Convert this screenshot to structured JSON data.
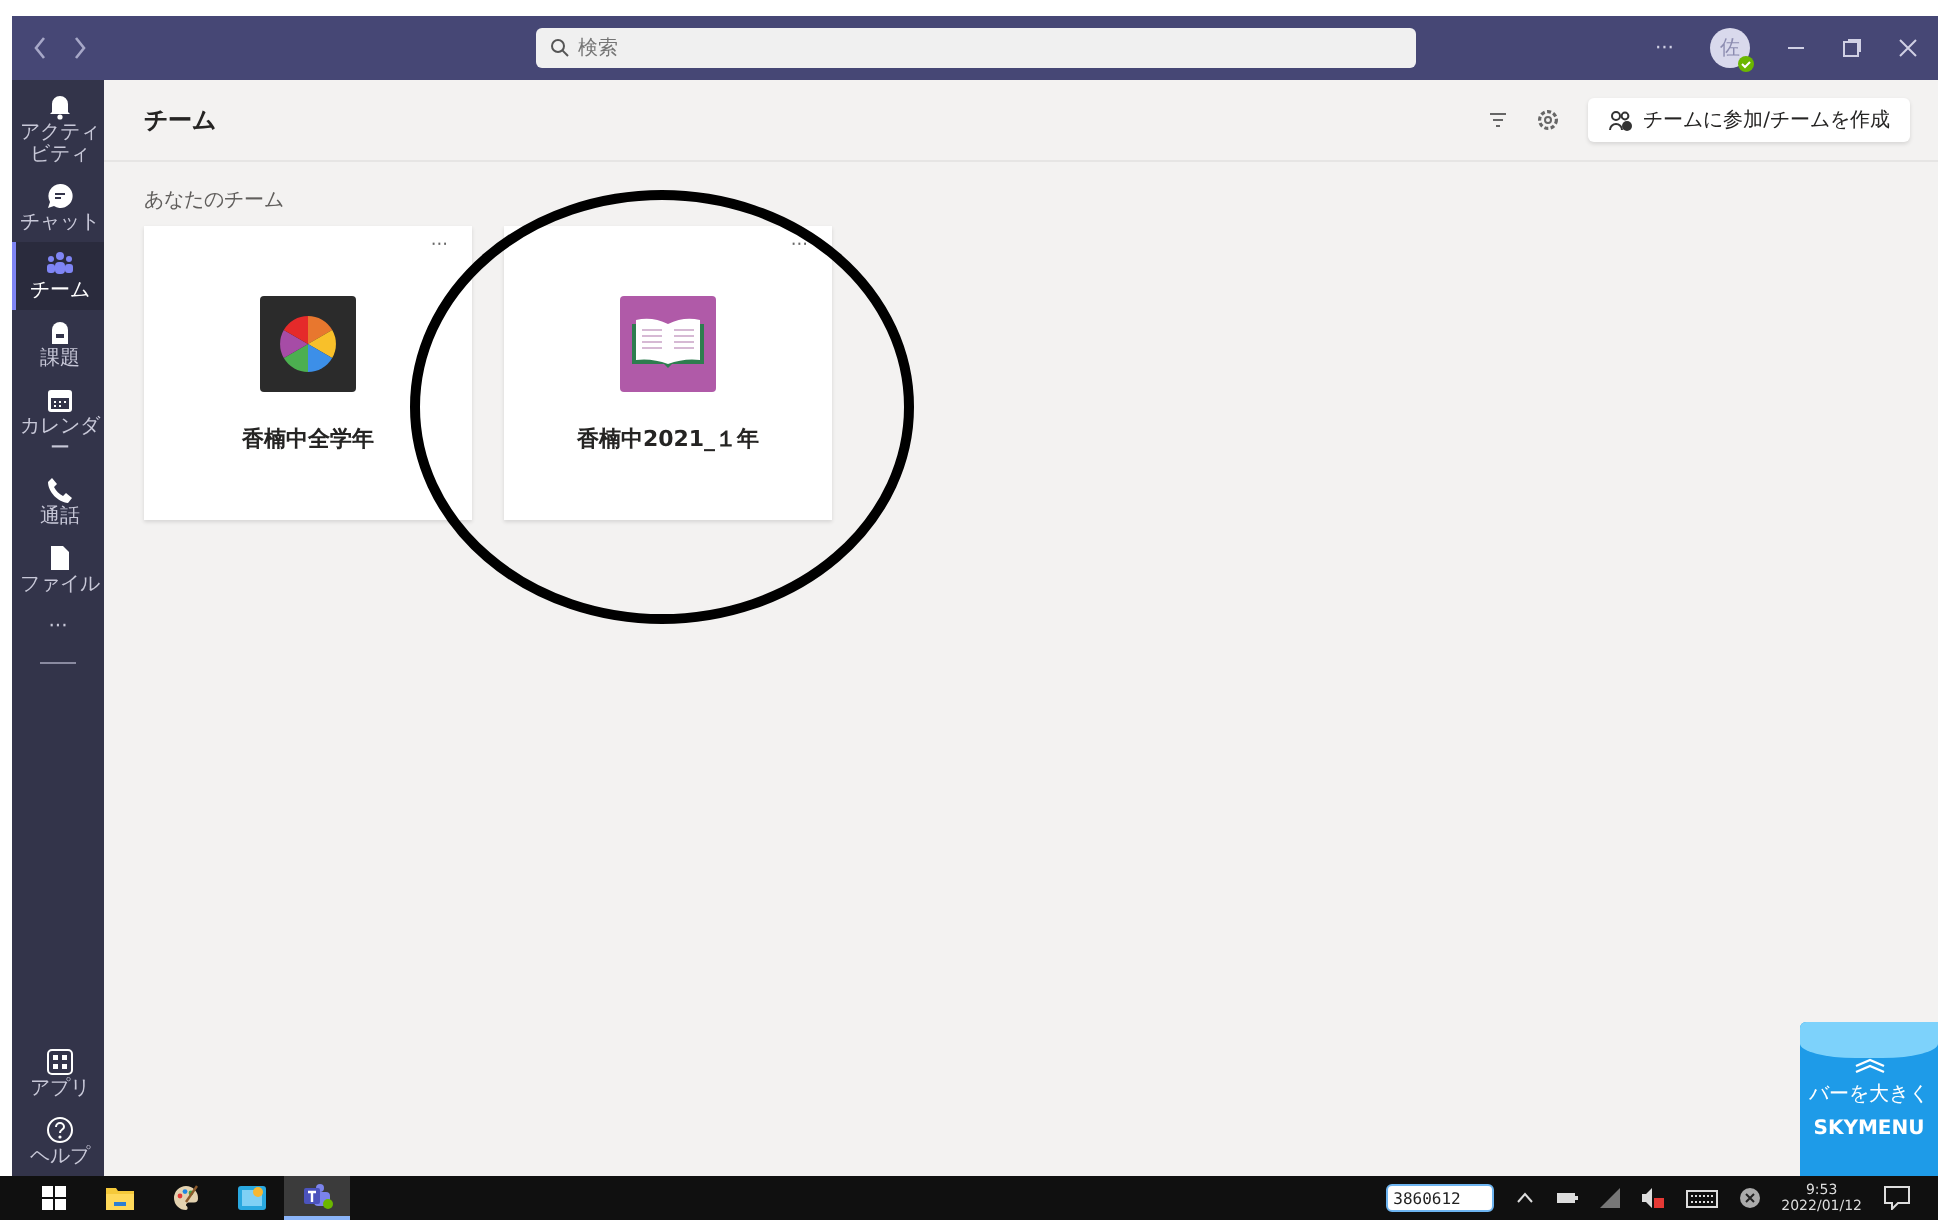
{
  "titlebar": {
    "search": {
      "placeholder": "検索"
    },
    "more": "···",
    "avatar": {
      "initial": "佐"
    }
  },
  "sidebar": {
    "items": [
      {
        "kind": "bell",
        "label": "アクティビティ",
        "selected": false
      },
      {
        "kind": "chat",
        "label": "チャット",
        "selected": false
      },
      {
        "kind": "team",
        "label": "チーム",
        "selected": true
      },
      {
        "kind": "bag",
        "label": "課題",
        "selected": false
      },
      {
        "kind": "calendar",
        "label": "カレンダー",
        "selected": false
      },
      {
        "kind": "call",
        "label": "通話",
        "selected": false
      },
      {
        "kind": "file",
        "label": "ファイル",
        "selected": false
      }
    ],
    "more": "···",
    "bottom": [
      {
        "kind": "apps",
        "label": "アプリ",
        "selected": false
      },
      {
        "kind": "help",
        "label": "ヘルプ",
        "selected": false
      }
    ]
  },
  "header": {
    "title": "チーム",
    "join_button": "チームに参加/チームを作成"
  },
  "section": {
    "title": "あなたのチーム",
    "teams": [
      {
        "name": "香楠中全学年",
        "kind": "pie",
        "more": "···"
      },
      {
        "name": "香楠中2021_１年",
        "kind": "book",
        "more": "···"
      }
    ]
  },
  "skymenu": {
    "label": "バーを大きく",
    "brand": "SKYMENU"
  },
  "taskbar": {
    "apps": [
      {
        "kind": "windows",
        "selected": false
      },
      {
        "kind": "folder",
        "selected": false
      },
      {
        "kind": "paint",
        "selected": false
      },
      {
        "kind": "viewer",
        "selected": false
      },
      {
        "kind": "teams",
        "selected": true
      }
    ],
    "ime_value": "3860612",
    "time": "9:53",
    "date": "2022/01/12"
  }
}
